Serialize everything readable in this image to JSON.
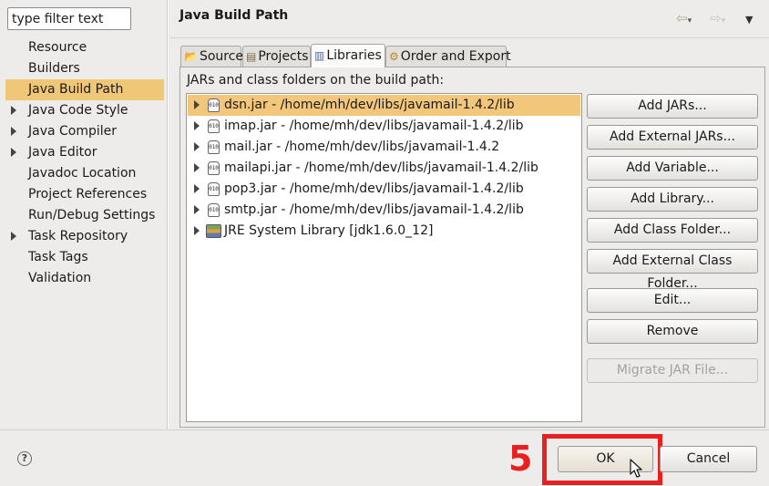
{
  "filter": {
    "value": "type filter text"
  },
  "nav": {
    "items": [
      {
        "label": "Resource",
        "expandable": false,
        "selected": false
      },
      {
        "label": "Builders",
        "expandable": false,
        "selected": false
      },
      {
        "label": "Java Build Path",
        "expandable": false,
        "selected": true
      },
      {
        "label": "Java Code Style",
        "expandable": true,
        "selected": false
      },
      {
        "label": "Java Compiler",
        "expandable": true,
        "selected": false
      },
      {
        "label": "Java Editor",
        "expandable": true,
        "selected": false
      },
      {
        "label": "Javadoc Location",
        "expandable": false,
        "selected": false
      },
      {
        "label": "Project References",
        "expandable": false,
        "selected": false
      },
      {
        "label": "Run/Debug Settings",
        "expandable": false,
        "selected": false
      },
      {
        "label": "Task Repository",
        "expandable": true,
        "selected": false
      },
      {
        "label": "Task Tags",
        "expandable": false,
        "selected": false
      },
      {
        "label": "Validation",
        "expandable": false,
        "selected": false
      }
    ]
  },
  "header": {
    "title": "Java Build Path",
    "back_icon": "back-arrow-icon",
    "forward_icon": "forward-arrow-icon",
    "menu_icon": "view-menu-icon"
  },
  "tabs": [
    {
      "label": "Source",
      "icon": "source-folder-icon",
      "active": false
    },
    {
      "label": "Projects",
      "icon": "projects-icon",
      "active": false
    },
    {
      "label": "Libraries",
      "icon": "libraries-icon",
      "active": true
    },
    {
      "label": "Order and Export",
      "icon": "order-export-icon",
      "active": false
    }
  ],
  "libraries": {
    "label": "JARs and class folders on the build path:",
    "items": [
      {
        "text": "dsn.jar - /home/mh/dev/libs/javamail-1.4.2/lib",
        "icon": "jar-icon",
        "selected": true
      },
      {
        "text": "imap.jar - /home/mh/dev/libs/javamail-1.4.2/lib",
        "icon": "jar-icon",
        "selected": false
      },
      {
        "text": "mail.jar - /home/mh/dev/libs/javamail-1.4.2",
        "icon": "jar-icon",
        "selected": false
      },
      {
        "text": "mailapi.jar - /home/mh/dev/libs/javamail-1.4.2/lib",
        "icon": "jar-icon",
        "selected": false
      },
      {
        "text": "pop3.jar - /home/mh/dev/libs/javamail-1.4.2/lib",
        "icon": "jar-icon",
        "selected": false
      },
      {
        "text": "smtp.jar - /home/mh/dev/libs/javamail-1.4.2/lib",
        "icon": "jar-icon",
        "selected": false
      },
      {
        "text": "JRE System Library [jdk1.6.0_12]",
        "icon": "jre-library-icon",
        "selected": false
      }
    ]
  },
  "buttons": {
    "add_jars": "Add JARs...",
    "add_external_jars": "Add External JARs...",
    "add_variable": "Add Variable...",
    "add_library": "Add Library...",
    "add_class_folder": "Add Class Folder...",
    "add_external_class_folder": "Add External Class Folder...",
    "edit": "Edit...",
    "remove": "Remove",
    "migrate_jar": "Migrate JAR File..."
  },
  "footer": {
    "help_icon": "help-icon",
    "ok": "OK",
    "cancel": "Cancel",
    "step_number": "5"
  },
  "colors": {
    "selection": "#f0c777",
    "highlight": "#e8201f",
    "background": "#edeceb"
  }
}
